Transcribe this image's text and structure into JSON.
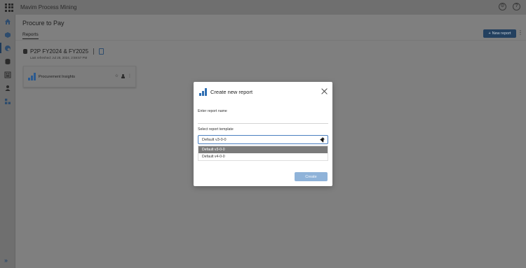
{
  "app": {
    "title": "Mavim Process Mining"
  },
  "topbar_icons": [
    {
      "name": "gear-icon",
      "glyph": "⚙"
    },
    {
      "name": "help-icon",
      "glyph": "?"
    }
  ],
  "sidebar": {
    "items": [
      {
        "name": "sidebar-item-home",
        "icon": "home-icon"
      },
      {
        "name": "sidebar-item-process",
        "icon": "cube-icon"
      },
      {
        "name": "sidebar-item-datasets",
        "icon": "database-active-icon"
      },
      {
        "name": "sidebar-item-storage",
        "icon": "cylinder-icon"
      },
      {
        "name": "sidebar-item-dashboard",
        "icon": "dashboard-icon"
      },
      {
        "name": "sidebar-item-users",
        "icon": "user-icon"
      },
      {
        "name": "sidebar-item-apps",
        "icon": "apps-icon"
      }
    ],
    "expand_glyph": "»"
  },
  "page": {
    "title": "Procure to Pay",
    "tabs": [
      {
        "label": "Reports"
      }
    ],
    "new_report_label": "New report",
    "new_report_glyph": "+"
  },
  "dataset": {
    "name": "P2P FY2024 & FY2025",
    "last_refreshed": "Last refreshed: Jul 28, 2024, 2:59:57 PM"
  },
  "report_card": {
    "title": "Procurement Insights",
    "star_glyph": "☆",
    "kebab_glyph": "⋮"
  },
  "modal": {
    "title": "Create new report",
    "name_label": "Enter report name",
    "name_value": "",
    "name_placeholder": "",
    "template_label": "Select report template",
    "template_selected": "Default v3-0-0",
    "template_options": [
      {
        "label": "Default v3-0-0",
        "selected": true
      },
      {
        "label": "Default v4-0-0",
        "selected": false
      }
    ],
    "create_label": "Create"
  },
  "colors": {
    "accent": "#2f6fb3",
    "primary_button": "#23405f",
    "create_disabled": "#8fb3d9",
    "overlay": "#7f7f7f"
  }
}
